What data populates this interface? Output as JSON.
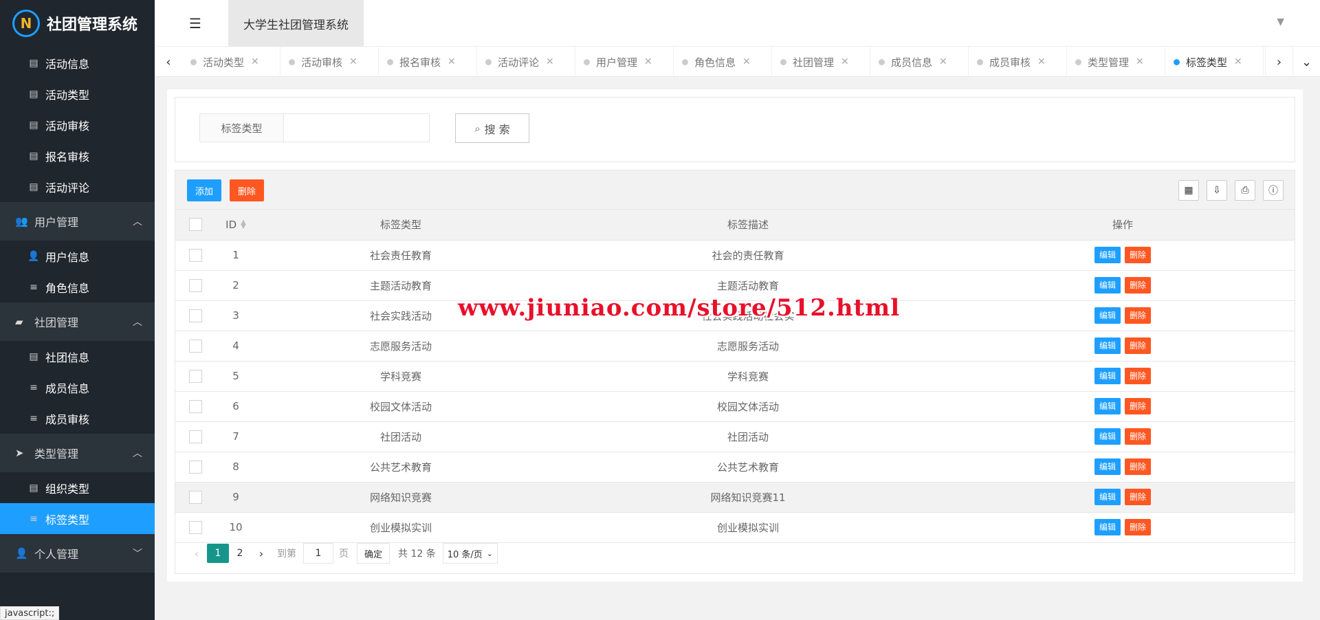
{
  "app": {
    "logo_text": "社团管理系统",
    "logo_letter": "N",
    "header_title": "大学生社团管理系统"
  },
  "sidebar": {
    "items": [
      {
        "kind": "item",
        "label": "活动信息",
        "icon": "list-icon"
      },
      {
        "kind": "item",
        "label": "活动类型",
        "icon": "list-icon"
      },
      {
        "kind": "item",
        "label": "活动审核",
        "icon": "list-icon"
      },
      {
        "kind": "item",
        "label": "报名审核",
        "icon": "list-icon"
      },
      {
        "kind": "item",
        "label": "活动评论",
        "icon": "list-icon"
      },
      {
        "kind": "group",
        "label": "用户管理",
        "icon": "users-icon",
        "arrow": "up"
      },
      {
        "kind": "item",
        "label": "用户信息",
        "icon": "user-icon"
      },
      {
        "kind": "item",
        "label": "角色信息",
        "icon": "bars-icon"
      },
      {
        "kind": "group",
        "label": "社团管理",
        "icon": "book-icon",
        "arrow": "up"
      },
      {
        "kind": "item",
        "label": "社团信息",
        "icon": "list-icon"
      },
      {
        "kind": "item",
        "label": "成员信息",
        "icon": "bars-icon"
      },
      {
        "kind": "item",
        "label": "成员审核",
        "icon": "bars-icon"
      },
      {
        "kind": "group",
        "label": "类型管理",
        "icon": "paper-plane-icon",
        "arrow": "up"
      },
      {
        "kind": "item",
        "label": "组织类型",
        "icon": "list-icon"
      },
      {
        "kind": "item",
        "label": "标签类型",
        "icon": "bars-icon",
        "active": true
      },
      {
        "kind": "group",
        "label": "个人管理",
        "icon": "user-icon",
        "arrow": "down"
      }
    ]
  },
  "status_bar": "javascript:;",
  "tabs": [
    {
      "label": "活动类型"
    },
    {
      "label": "活动审核"
    },
    {
      "label": "报名审核"
    },
    {
      "label": "活动评论"
    },
    {
      "label": "用户管理"
    },
    {
      "label": "角色信息"
    },
    {
      "label": "社团管理"
    },
    {
      "label": "成员信息"
    },
    {
      "label": "成员审核"
    },
    {
      "label": "类型管理"
    },
    {
      "label": "标签类型",
      "active": true
    }
  ],
  "search": {
    "label": "标签类型",
    "value": "",
    "button": "搜 索"
  },
  "toolbar": {
    "add": "添加",
    "delete": "删除"
  },
  "table": {
    "headers": {
      "id": "ID",
      "type": "标签类型",
      "desc": "标签描述",
      "op": "操作"
    },
    "edit_label": "编辑",
    "delete_label": "删除",
    "rows": [
      {
        "id": "1",
        "type": "社会责任教育",
        "desc": "社会的责任教育"
      },
      {
        "id": "2",
        "type": "主题活动教育",
        "desc": "主题活动教育"
      },
      {
        "id": "3",
        "type": "社会实践活动",
        "desc": "社会实践活动社会实"
      },
      {
        "id": "4",
        "type": "志愿服务活动",
        "desc": "志愿服务活动"
      },
      {
        "id": "5",
        "type": "学科竞赛",
        "desc": "学科竞赛"
      },
      {
        "id": "6",
        "type": "校园文体活动",
        "desc": "校园文体活动"
      },
      {
        "id": "7",
        "type": "社团活动",
        "desc": "社团活动"
      },
      {
        "id": "8",
        "type": "公共艺术教育",
        "desc": "公共艺术教育"
      },
      {
        "id": "9",
        "type": "网络知识竞赛",
        "desc": "网络知识竞赛11",
        "hover": true
      },
      {
        "id": "10",
        "type": "创业模拟实训",
        "desc": "创业模拟实训"
      }
    ]
  },
  "pager": {
    "pages": [
      "1",
      "2"
    ],
    "current": "1",
    "goto_label": "到第",
    "goto_value": "1",
    "page_unit": "页",
    "confirm": "确定",
    "total": "共 12 条",
    "page_size": "10 条/页"
  },
  "watermark": "www.jiuniao.com/store/512.html",
  "colors": {
    "primary": "#1e9fff",
    "danger": "#ff5722",
    "sidebar_bg": "#1f262d",
    "pager_current": "#16968a"
  }
}
